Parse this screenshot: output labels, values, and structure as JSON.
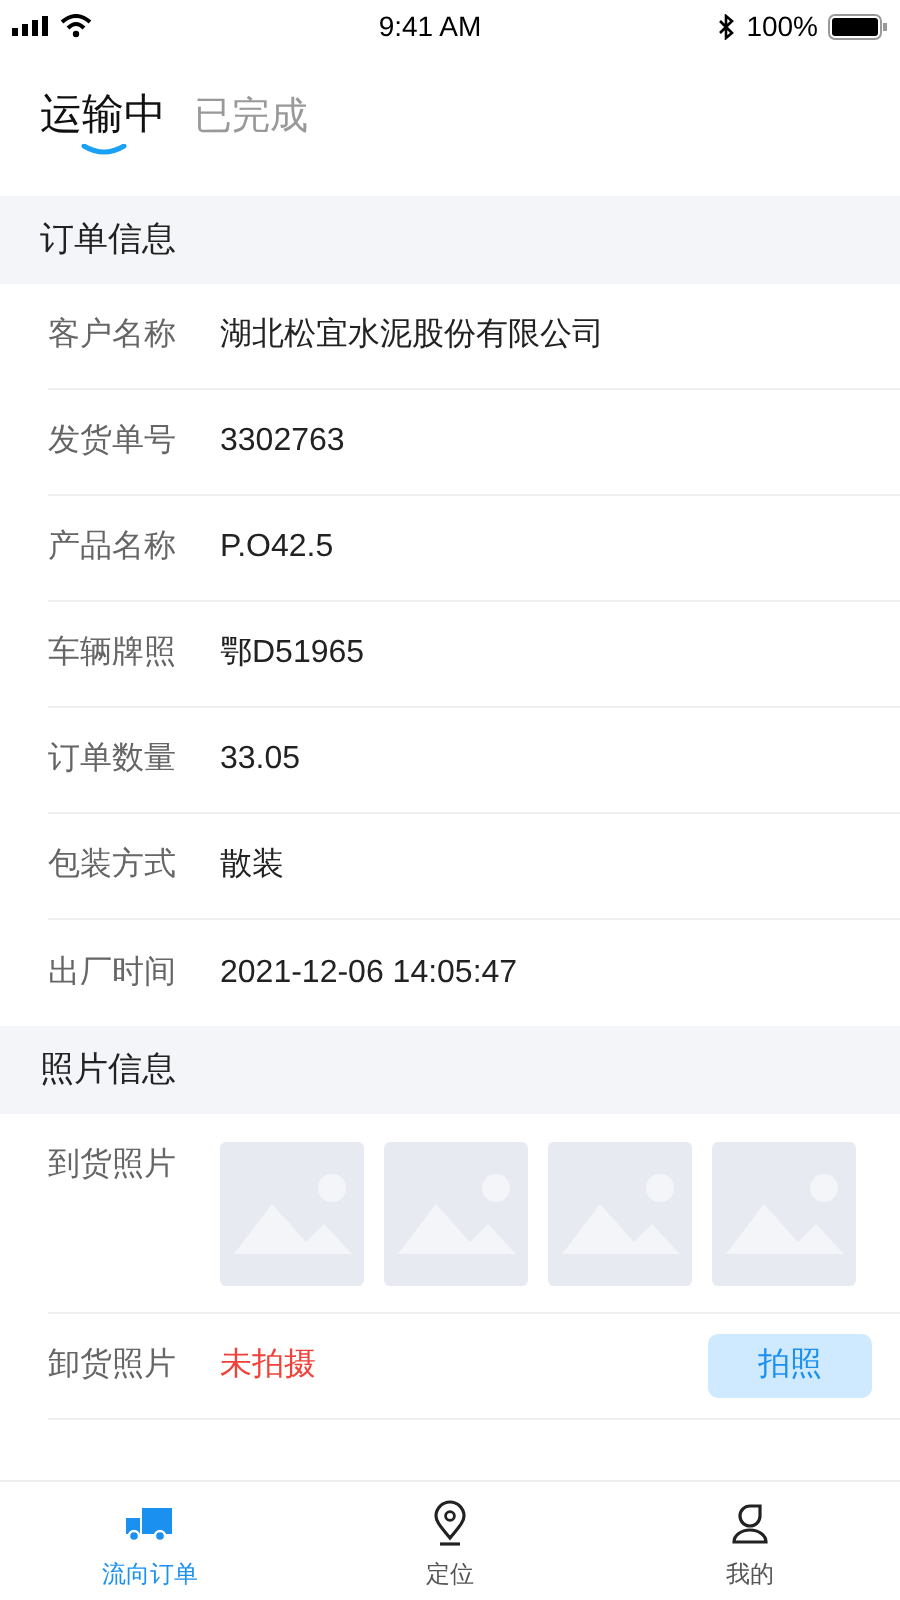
{
  "status_bar": {
    "time": "9:41 AM",
    "battery": "100%"
  },
  "tabs": [
    {
      "label": "运输中",
      "selected": true
    },
    {
      "label": "已完成",
      "selected": false
    }
  ],
  "order_section": {
    "title": "订单信息",
    "rows": [
      {
        "label": "客户名称",
        "value": "湖北松宜水泥股份有限公司"
      },
      {
        "label": "发货单号",
        "value": "3302763"
      },
      {
        "label": "产品名称",
        "value": "P.O42.5"
      },
      {
        "label": "车辆牌照",
        "value": "鄂D51965"
      },
      {
        "label": "订单数量",
        "value": "33.05"
      },
      {
        "label": "包装方式",
        "value": "散装"
      },
      {
        "label": "出厂时间",
        "value": "2021-12-06 14:05:47"
      }
    ]
  },
  "photo_section": {
    "title": "照片信息",
    "arrival": {
      "label": "到货照片",
      "photos": [
        {
          "kind": "placeholder"
        },
        {
          "kind": "placeholder"
        },
        {
          "kind": "placeholder"
        },
        {
          "kind": "placeholder"
        }
      ]
    },
    "unloading": {
      "label": "卸货照片",
      "status": "未拍摄",
      "button": "拍照"
    }
  },
  "bottom_nav": [
    {
      "label": "流向订单",
      "selected": true,
      "kind": "truck"
    },
    {
      "label": "定位",
      "selected": false,
      "kind": "pin"
    },
    {
      "label": "我的",
      "selected": false,
      "kind": "person"
    }
  ]
}
